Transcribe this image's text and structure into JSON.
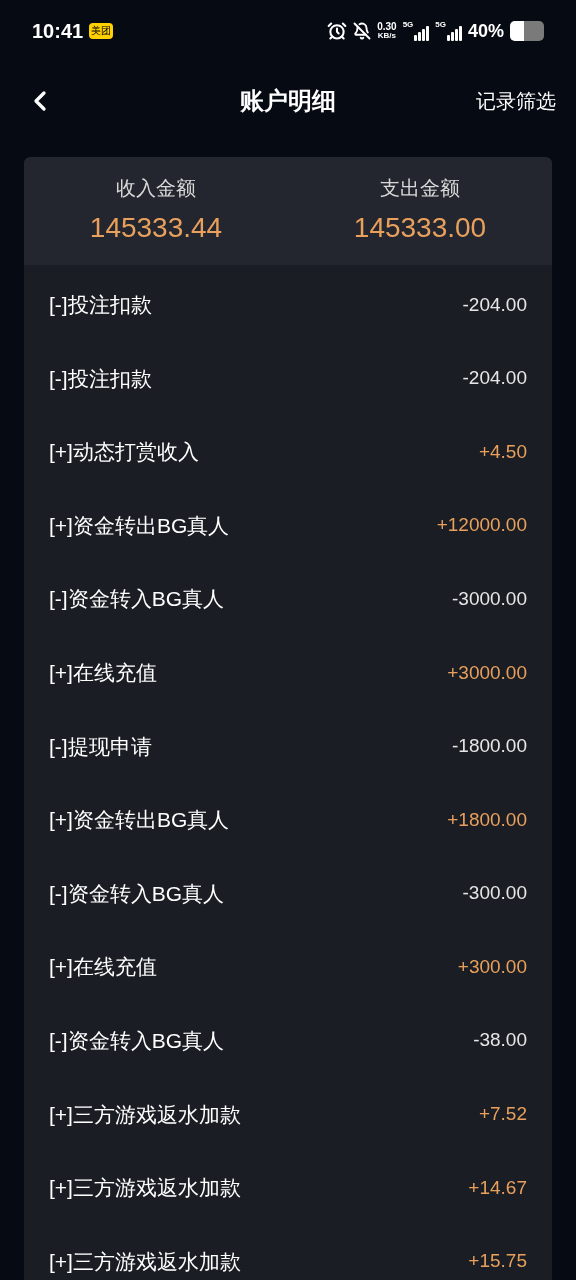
{
  "status_bar": {
    "time": "10:41",
    "app_badge": "美团",
    "net_speed": "0.30",
    "net_unit": "KB/s",
    "sim": [
      "5G",
      "5G"
    ],
    "battery": "40%"
  },
  "header": {
    "title": "账户明细",
    "action": "记录筛选"
  },
  "summary": [
    {
      "label": "收入金额",
      "value": "145333.44"
    },
    {
      "label": "支出金额",
      "value": "145333.00"
    }
  ],
  "records": [
    {
      "kind": "expense",
      "title": "[-]投注扣款",
      "amount": "-204.00"
    },
    {
      "kind": "expense",
      "title": "[-]投注扣款",
      "amount": "-204.00"
    },
    {
      "kind": "income",
      "title": "[+]动态打赏收入",
      "amount": "+4.50"
    },
    {
      "kind": "income",
      "title": "[+]资金转出BG真人",
      "amount": "+12000.00"
    },
    {
      "kind": "expense",
      "title": "[-]资金转入BG真人",
      "amount": "-3000.00"
    },
    {
      "kind": "income",
      "title": "[+]在线充值",
      "amount": "+3000.00"
    },
    {
      "kind": "expense",
      "title": "[-]提现申请",
      "amount": "-1800.00"
    },
    {
      "kind": "income",
      "title": "[+]资金转出BG真人",
      "amount": "+1800.00"
    },
    {
      "kind": "expense",
      "title": "[-]资金转入BG真人",
      "amount": "-300.00"
    },
    {
      "kind": "income",
      "title": "[+]在线充值",
      "amount": "+300.00"
    },
    {
      "kind": "expense",
      "title": "[-]资金转入BG真人",
      "amount": "-38.00"
    },
    {
      "kind": "income",
      "title": "[+]三方游戏返水加款",
      "amount": "+7.52"
    },
    {
      "kind": "income",
      "title": "[+]三方游戏返水加款",
      "amount": "+14.67"
    },
    {
      "kind": "income",
      "title": "[+]三方游戏返水加款",
      "amount": "+15.75"
    }
  ]
}
